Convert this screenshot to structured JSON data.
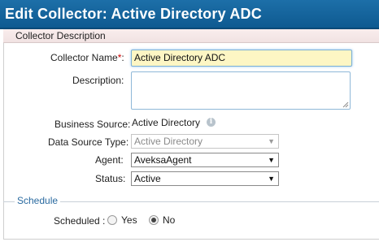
{
  "window": {
    "title": "Edit Collector: Active Directory ADC"
  },
  "section": {
    "description_header": "Collector Description"
  },
  "form": {
    "collector_name_label": "Collector Name",
    "collector_name_required": "*",
    "collector_name_colon": ":",
    "collector_name_value": "Active Directory ADC",
    "description_label": "Description:",
    "description_value": "",
    "business_source_label": "Business Source:",
    "business_source_value": "Active Directory",
    "data_source_type_label": "Data Source Type:",
    "data_source_type_value": "Active Directory",
    "agent_label": "Agent:",
    "agent_value": "AveksaAgent",
    "status_label": "Status:",
    "status_value": "Active"
  },
  "schedule": {
    "legend": "Schedule",
    "scheduled_label": "Scheduled :",
    "option_yes": "Yes",
    "option_no": "No",
    "selected": "No"
  },
  "icons": {
    "info": "info-icon",
    "dropdown": "chevron-down-icon"
  },
  "colors": {
    "title_bar": "#0e5a91",
    "required_star": "#cc0000",
    "name_input_bg": "#fdf6c4",
    "legend_text": "#2a6aa0"
  }
}
